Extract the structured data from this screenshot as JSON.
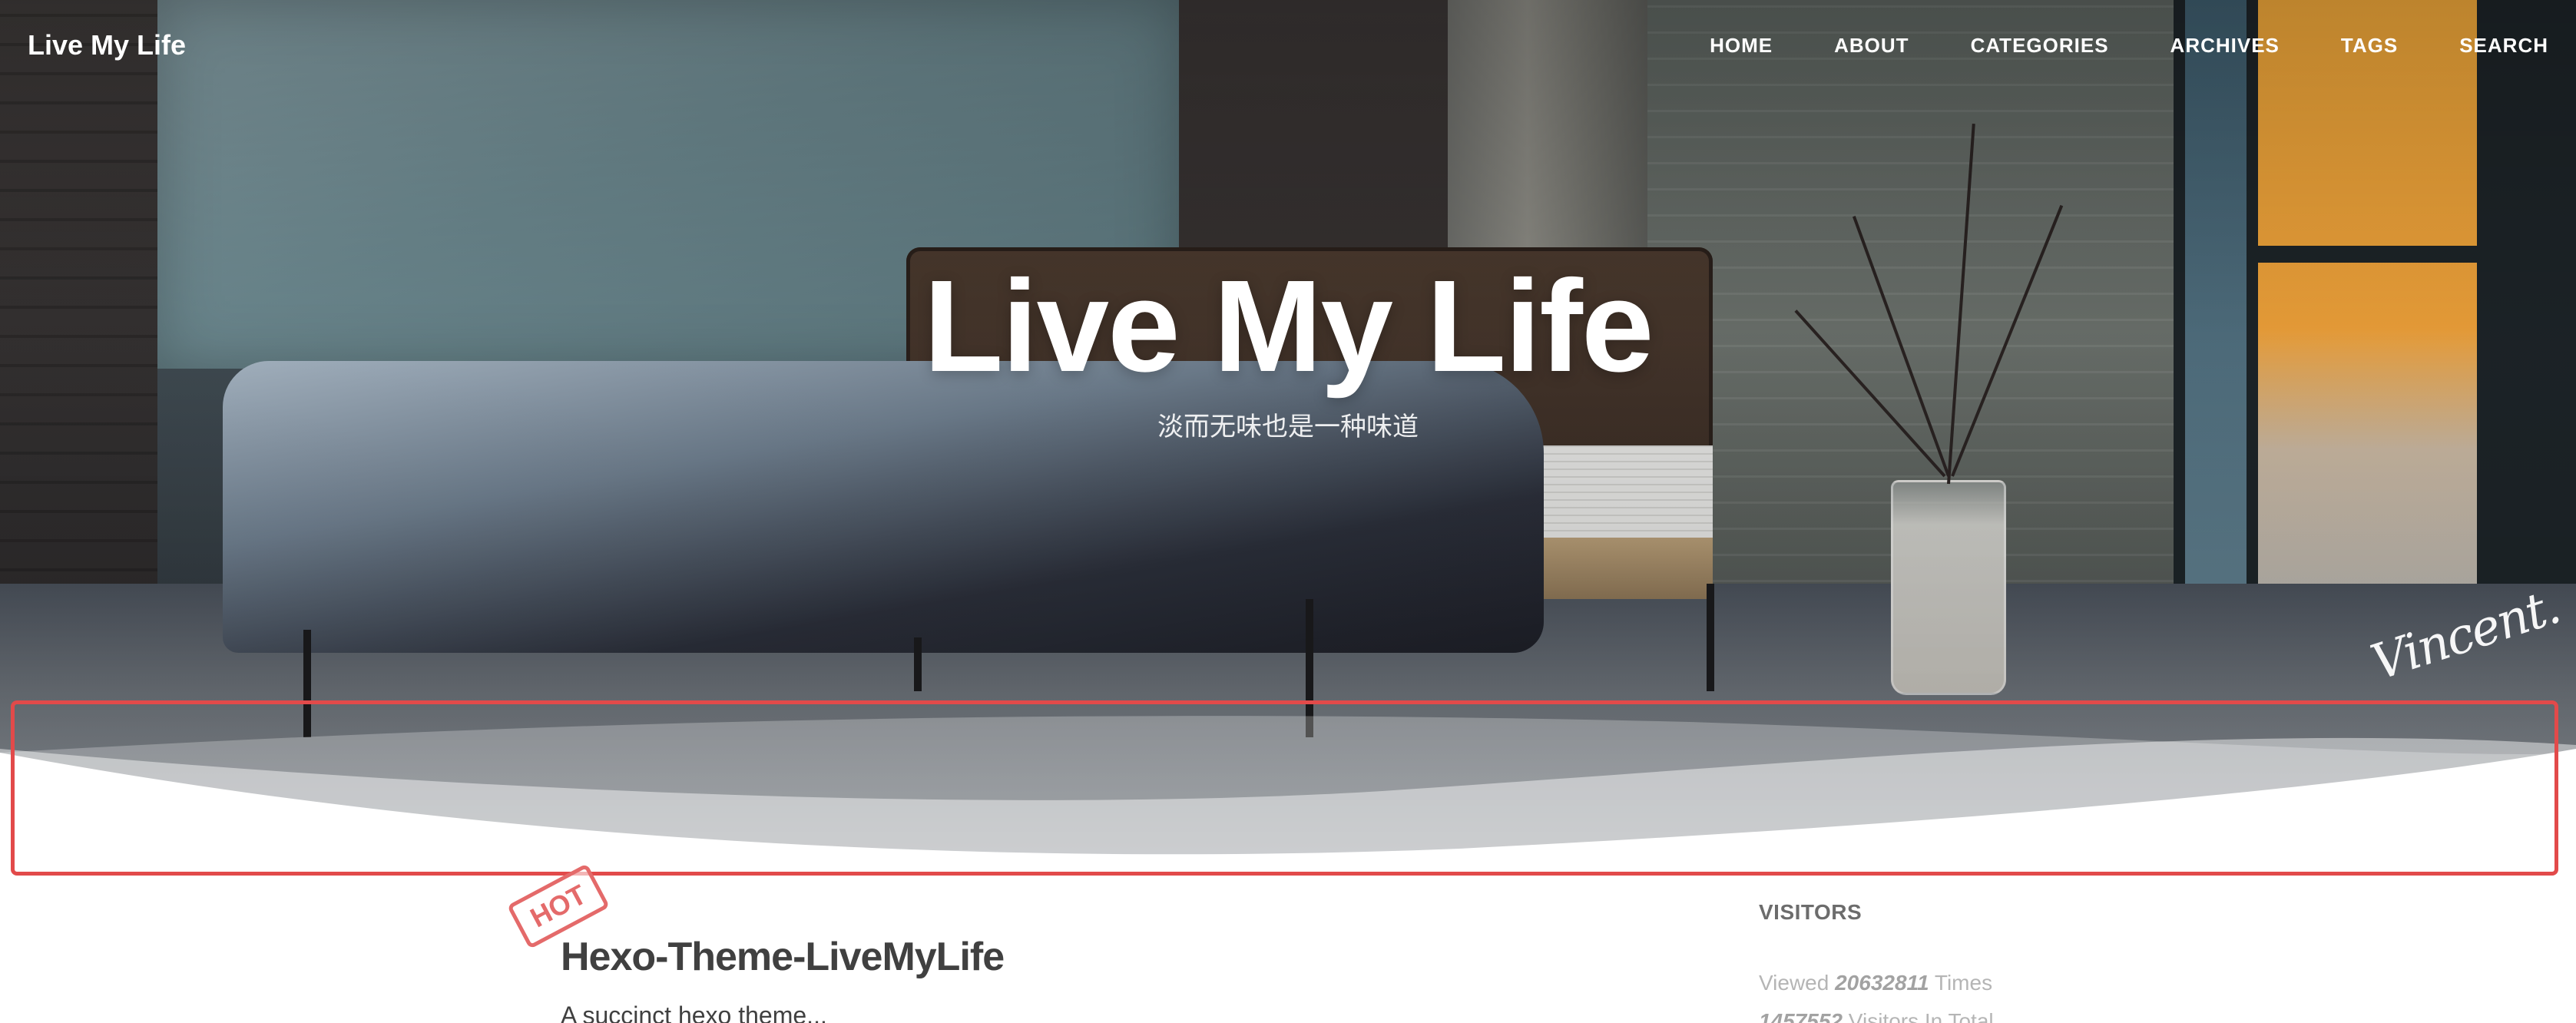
{
  "navbar": {
    "brand": "Live My Life",
    "links": [
      "HOME",
      "ABOUT",
      "CATEGORIES",
      "ARCHIVES",
      "TAGS",
      "SEARCH"
    ]
  },
  "hero": {
    "title": "Live My Life",
    "subtitle": "淡而无味也是一种味道",
    "signature": "Vincent."
  },
  "post": {
    "badge": "HOT",
    "title": "Hexo-Theme-LiveMyLife",
    "subtitle": "A succinct hexo theme..."
  },
  "sidebar": {
    "heading": "VISITORS",
    "views_prefix": "Viewed",
    "views_count": "20632811",
    "views_suffix": "Times",
    "visitors_count": "1457552",
    "visitors_suffix": "Visitors In Total"
  },
  "colors": {
    "highlight": "#e24a4a",
    "badge": "#e46a6a",
    "title_text": "#404040",
    "muted_text": "#b5b5b5"
  }
}
